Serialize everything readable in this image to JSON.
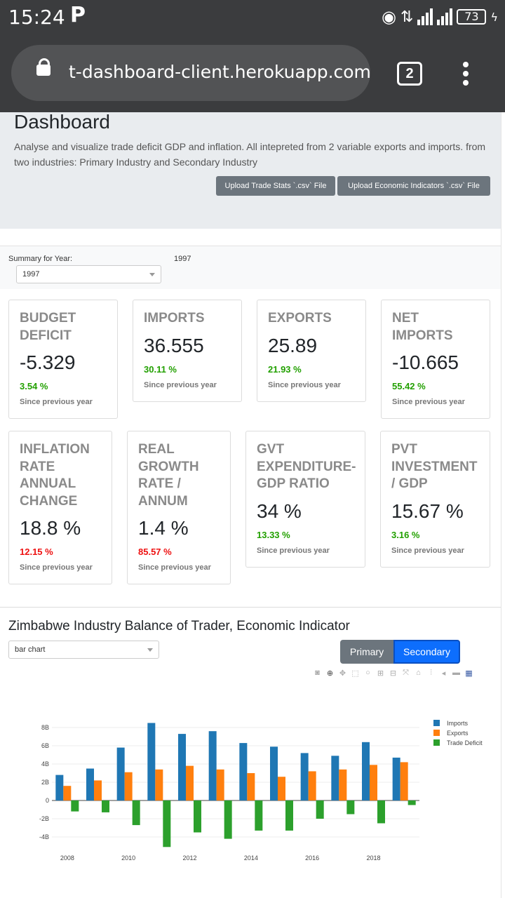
{
  "status": {
    "time": "15:24",
    "p_icon": "P",
    "battery": "73"
  },
  "browser": {
    "url": "t-dashboard-client.herokuapp.com",
    "tab_count": "2"
  },
  "header": {
    "title": "Dashboard",
    "description": "Analyse and visualize trade deficit GDP and inflation. All intepreted from 2 variable exports and imports. from two industries: Primary Industry and Secondary Industry",
    "upload_trade": "Upload Trade Stats `.csv` File",
    "upload_econ": "Upload Economic Indicators `.csv` File"
  },
  "summary": {
    "label": "Summary for Year:",
    "year_display": "1997",
    "selected_year": "1997"
  },
  "cards": [
    {
      "title": "BUDGET DEFICIT",
      "value": "-5.329",
      "change": "3.54 %",
      "trend": "up",
      "since": "Since previous year"
    },
    {
      "title": "IMPORTS",
      "value": "36.555",
      "change": "30.11 %",
      "trend": "up",
      "since": "Since previous year"
    },
    {
      "title": "EXPORTS",
      "value": "25.89",
      "change": "21.93 %",
      "trend": "up",
      "since": "Since previous year"
    },
    {
      "title": "NET IMPORTS",
      "value": "-10.665",
      "change": "55.42 %",
      "trend": "up",
      "since": "Since previous year"
    },
    {
      "title": "INFLATION RATE ANNUAL CHANGE",
      "value": "18.8 %",
      "change": "12.15 %",
      "trend": "down",
      "since": "Since previous year"
    },
    {
      "title": "REAL GROWTH RATE / ANNUM",
      "value": "1.4 %",
      "change": "85.57 %",
      "trend": "down",
      "since": "Since previous year"
    },
    {
      "title": "GVT EXPENDITURE-GDP RATIO",
      "value": "34 %",
      "change": "13.33 %",
      "trend": "up",
      "since": "Since previous year"
    },
    {
      "title": "PVT INVESTMENT / GDP",
      "value": "15.67 %",
      "change": "3.16 %",
      "trend": "up",
      "since": "Since previous year"
    }
  ],
  "chart_section": {
    "title": "Zimbabwe Industry Balance of Trader, Economic Indicator",
    "chart_type_select": "bar chart",
    "primary_label": "Primary",
    "secondary_label": "Secondary"
  },
  "chart_data": {
    "type": "bar",
    "title": "",
    "categories": [
      2008,
      2009,
      2010,
      2011,
      2012,
      2013,
      2014,
      2015,
      2016,
      2017,
      2018,
      2019
    ],
    "series": [
      {
        "name": "Imports",
        "color": "#1f77b4",
        "values": [
          2.8,
          3.5,
          5.8,
          8.5,
          7.3,
          7.6,
          6.3,
          5.9,
          5.2,
          4.9,
          6.4,
          4.7
        ]
      },
      {
        "name": "Exports",
        "color": "#ff7f0e",
        "values": [
          1.6,
          2.2,
          3.1,
          3.4,
          3.8,
          3.4,
          3.0,
          2.6,
          3.2,
          3.4,
          3.9,
          4.2
        ]
      },
      {
        "name": "Trade Deficit",
        "color": "#2ca02c",
        "values": [
          -1.2,
          -1.3,
          -2.7,
          -5.1,
          -3.5,
          -4.2,
          -3.3,
          -3.3,
          -2.0,
          -1.5,
          -2.5,
          -0.5
        ]
      }
    ],
    "y_ticks": [
      "8B",
      "6B",
      "4B",
      "2B",
      "0",
      "-2B",
      "-4B"
    ],
    "y_tick_values": [
      8,
      6,
      4,
      2,
      0,
      -2,
      -4
    ],
    "x_ticks": [
      "2008",
      "2010",
      "2012",
      "2014",
      "2016",
      "2018"
    ],
    "x_tick_values": [
      2008,
      2010,
      2012,
      2014,
      2016,
      2018
    ],
    "ylim": [
      -5.5,
      9.5
    ],
    "grid": true,
    "legend_position": "top-right"
  }
}
